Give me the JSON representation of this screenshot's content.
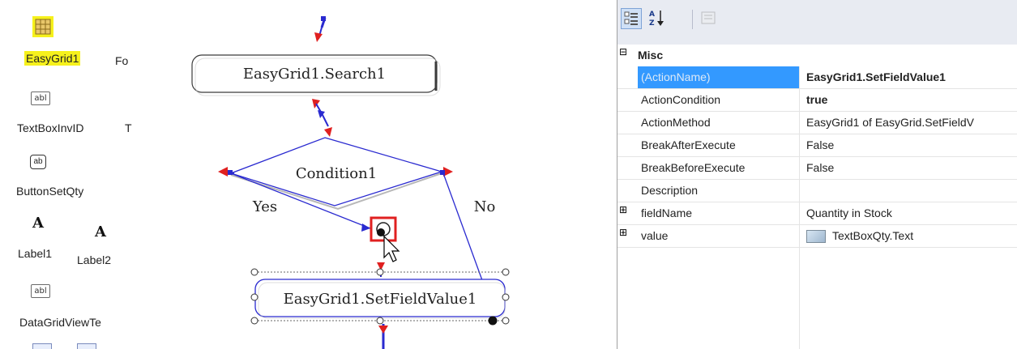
{
  "toolbox": {
    "items": [
      {
        "label": "EasyGrid1",
        "icon": "grid-icon",
        "highlighted": true
      },
      {
        "label": "Fo",
        "icon": ""
      },
      {
        "label": "TextBoxInvID",
        "icon": "textbox-icon"
      },
      {
        "label": "T",
        "icon": ""
      },
      {
        "label": "ButtonSetQty",
        "icon": "button-icon"
      },
      {
        "label": "Label1",
        "icon": "label-icon"
      },
      {
        "label": "Label2",
        "icon": "label-icon"
      },
      {
        "label": "DataGridViewTe",
        "icon": "textbox-icon"
      }
    ],
    "abl_glyph": "abl",
    "ab_glyph": "ab",
    "a_glyph": "A",
    "highlight_color": "#f6f11c"
  },
  "flowchart": {
    "node_search": "EasyGrid1.Search1",
    "node_condition": "Condition1",
    "node_setfield": "EasyGrid1.SetFieldValue1",
    "edge_yes": "Yes",
    "edge_no": "No",
    "colors": {
      "edge": "#2a2ad0",
      "arrow_red": "#e02020",
      "selection": "#e02020"
    }
  },
  "properties": {
    "toolbar": [
      {
        "name": "categorized-icon",
        "active": true
      },
      {
        "name": "sort-alpha-icon",
        "active": false
      },
      {
        "name": "property-pages-icon",
        "active": false
      }
    ],
    "category": {
      "label": "Misc",
      "expander": "⊟"
    },
    "rows": [
      {
        "name": "(ActionName)",
        "value": "EasyGrid1.SetFieldValue1",
        "selected": true,
        "bold_value": true
      },
      {
        "name": "ActionCondition",
        "value": "true",
        "bold_value": true
      },
      {
        "name": "ActionMethod",
        "value": "EasyGrid1 of EasyGrid.SetFieldV"
      },
      {
        "name": "BreakAfterExecute",
        "value": "False"
      },
      {
        "name": "BreakBeforeExecute",
        "value": "False"
      },
      {
        "name": "Description",
        "value": ""
      },
      {
        "name": "fieldName",
        "value": "Quantity in Stock",
        "expander": "⊞"
      },
      {
        "name": "value",
        "value": "TextBoxQty.Text",
        "expander": "⊞",
        "value_icon": "image-thumbnail-icon"
      }
    ],
    "selected_color": "#3399ff"
  }
}
